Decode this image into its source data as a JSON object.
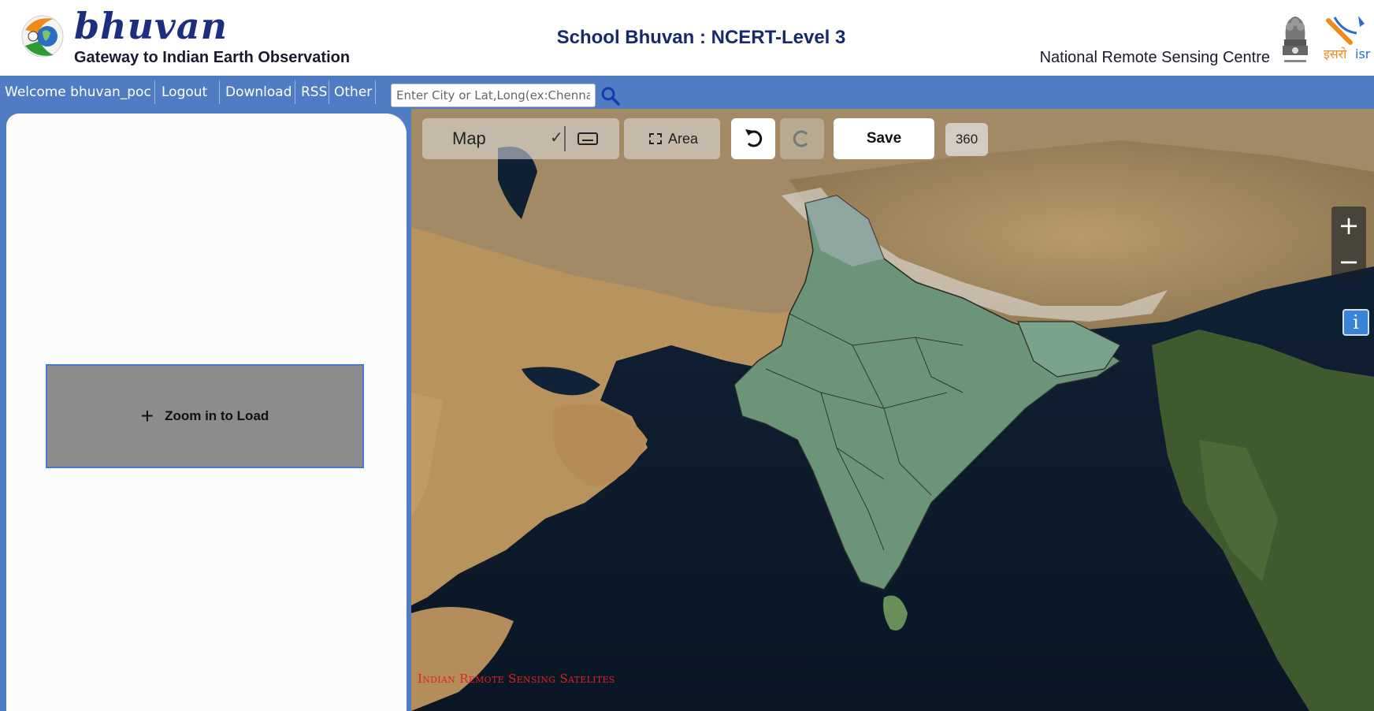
{
  "header": {
    "brand_name": "bhuvan",
    "brand_tagline": "Gateway to Indian Earth Observation",
    "page_title": "School Bhuvan : NCERT-Level 3",
    "org_name": "National Remote Sensing Centre"
  },
  "nav": {
    "items": [
      {
        "label": "Welcome bhuvan_poc"
      },
      {
        "label": "Logout"
      },
      {
        "label": "Download"
      },
      {
        "label": "RSS"
      },
      {
        "label": "Other"
      }
    ],
    "search_placeholder": "Enter City or Lat,Long(ex:Chennai or"
  },
  "left_panel": {
    "zoom_label": "Zoom in to Load"
  },
  "map_toolbar": {
    "map_label": "Map",
    "area_label": "Area",
    "save_label": "Save",
    "view_360_label": "360"
  },
  "map_controls": {
    "zoom_in": "+",
    "zoom_out": "−",
    "info": "i"
  },
  "attribution": "Indian Remote Sensing Satelites",
  "colors": {
    "nav_blue": "#4f7cc2",
    "title_navy": "#172a6e",
    "attribution_red": "#e02222",
    "info_blue": "#3a84d8"
  },
  "icons": [
    "search-icon",
    "keyboard-icon",
    "check-icon",
    "area-select-icon",
    "undo-icon",
    "redo-icon",
    "plus-icon",
    "minus-icon",
    "info-icon"
  ]
}
